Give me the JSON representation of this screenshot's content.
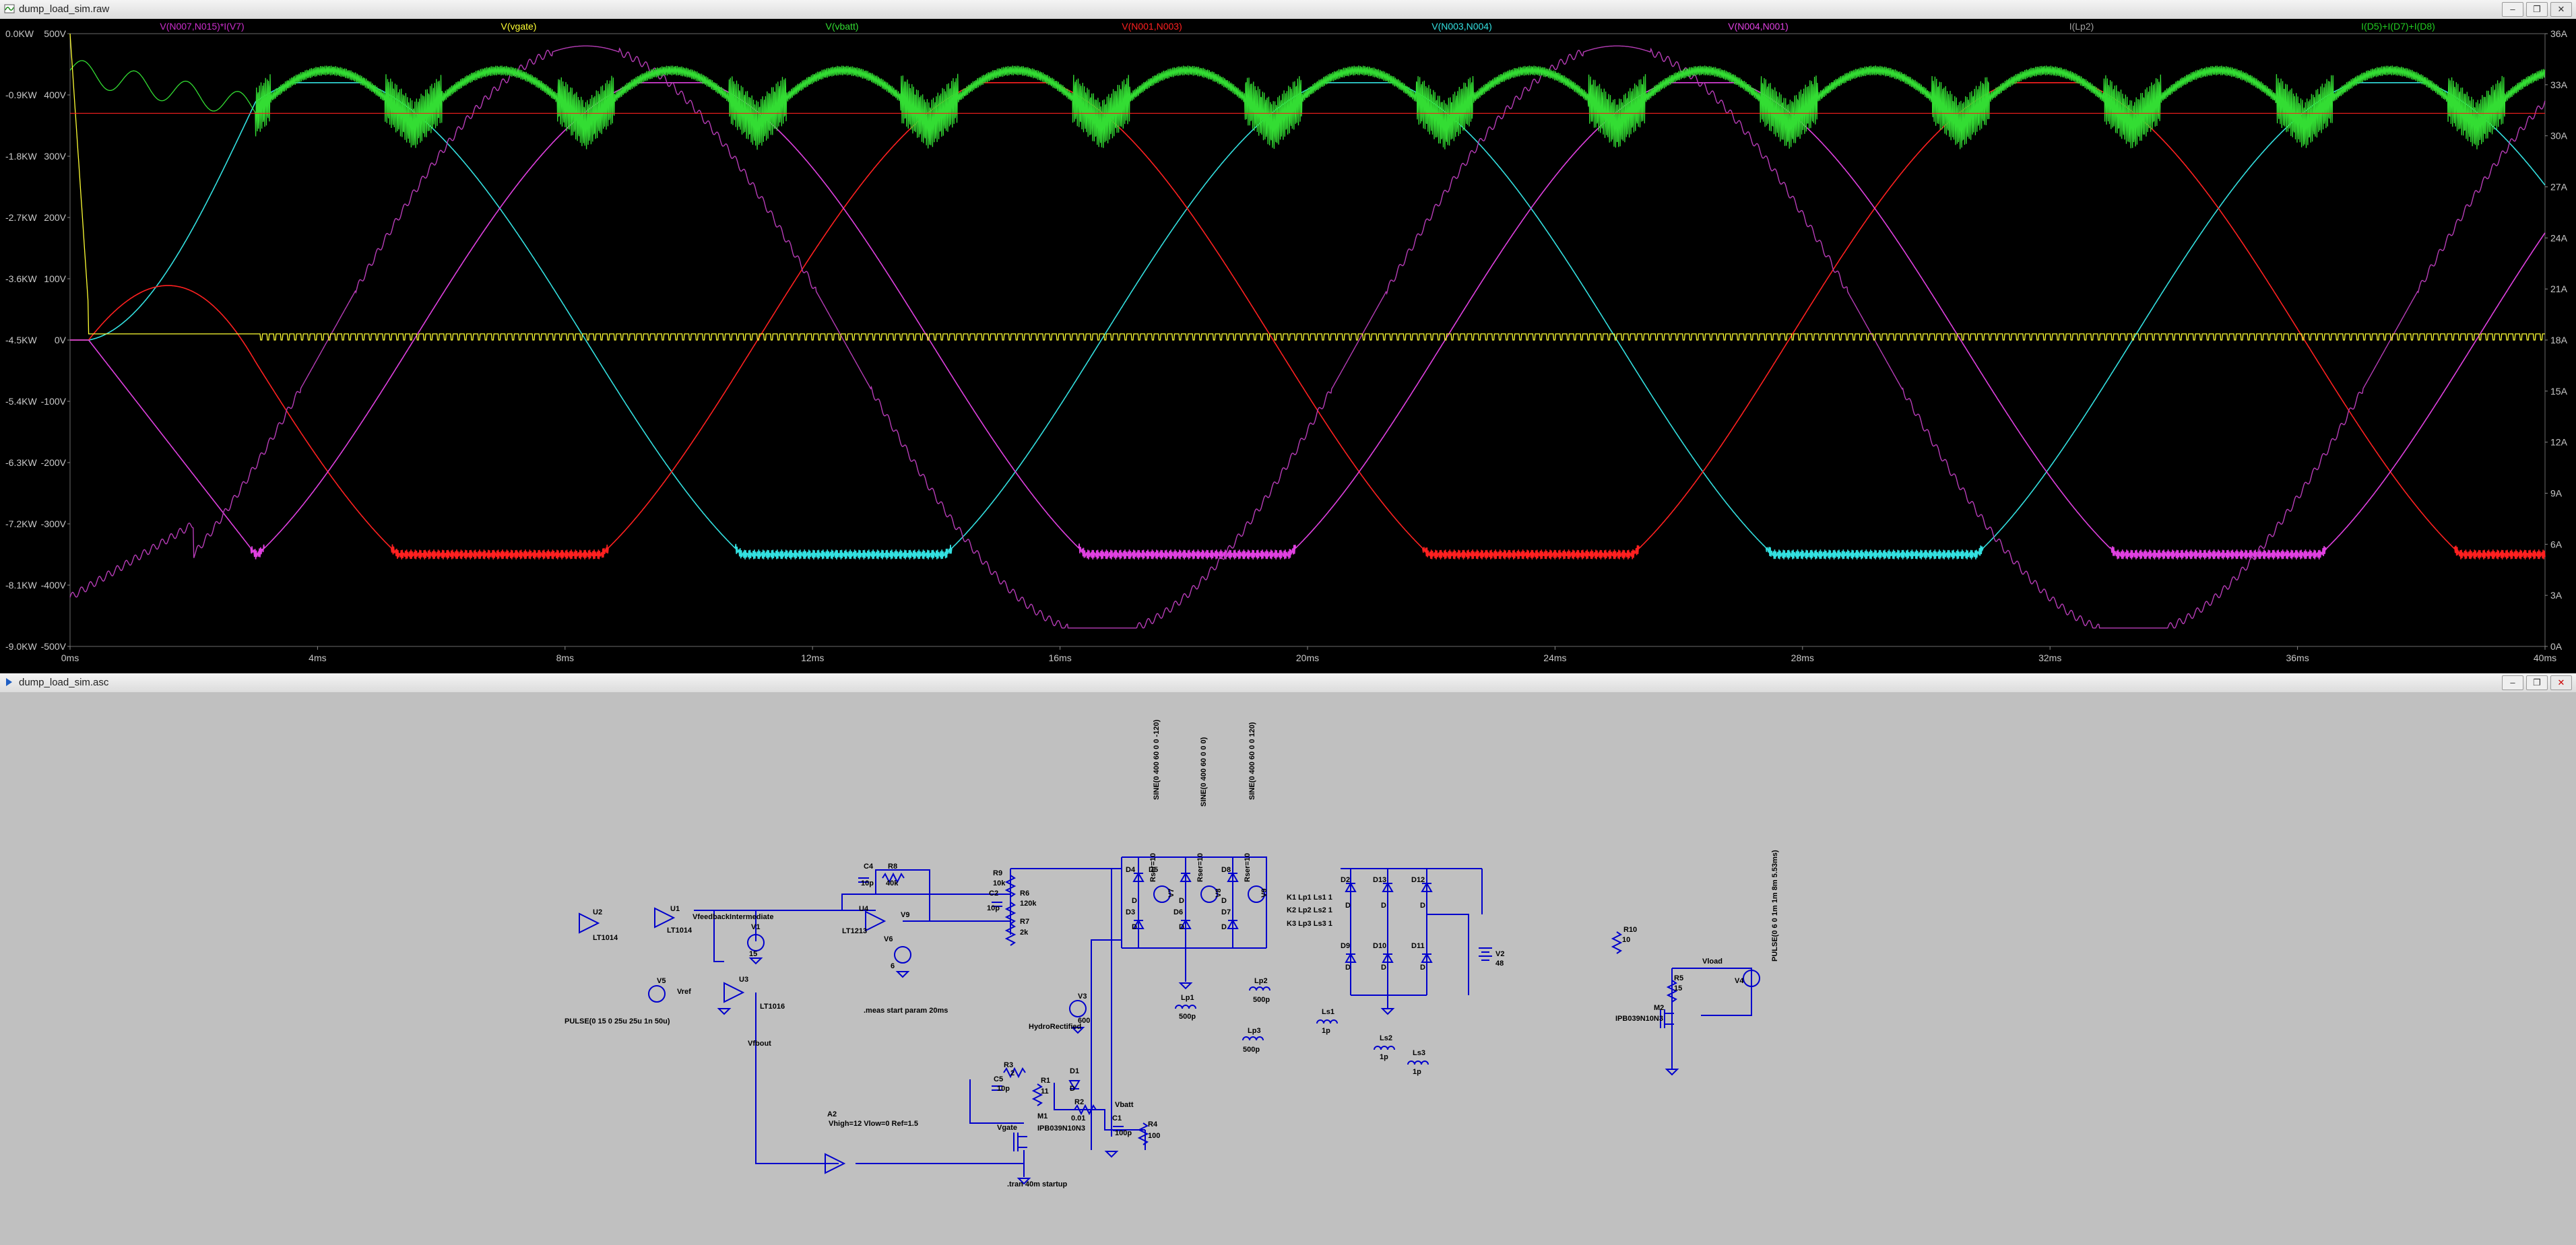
{
  "plot_window": {
    "title": "dump_load_sim.raw",
    "buttons": [
      "minimize",
      "restore",
      "close"
    ],
    "trace_labels": [
      {
        "text": "V(N007,N015)*I(V7)",
        "color": "#cc2ecc"
      },
      {
        "text": "V(vgate)",
        "color": "#ffff33"
      },
      {
        "text": "V(vbatt)",
        "color": "#33dd33"
      },
      {
        "text": "V(N001,N003)",
        "color": "#ff2020"
      },
      {
        "text": "V(N003,N004)",
        "color": "#33e0e0"
      },
      {
        "text": "V(N004,N001)",
        "color": "#e040e0"
      },
      {
        "text": "I(Lp2)",
        "color": "#a0a0a0"
      },
      {
        "text": "I(D5)+I(D7)+I(D8)",
        "color": "#22cc22"
      }
    ],
    "left_axis_1": [
      "0.0KW",
      "-0.9KW",
      "-1.8KW",
      "-2.7KW",
      "-3.6KW",
      "-4.5KW",
      "-5.4KW",
      "-6.3KW",
      "-7.2KW",
      "-8.1KW",
      "-9.0KW"
    ],
    "left_axis_2": [
      "500V",
      "400V",
      "300V",
      "200V",
      "100V",
      "0V",
      "-100V",
      "-200V",
      "-300V",
      "-400V",
      "-500V"
    ],
    "right_axis": [
      "36A",
      "33A",
      "30A",
      "27A",
      "24A",
      "21A",
      "18A",
      "15A",
      "12A",
      "9A",
      "6A",
      "3A",
      "0A"
    ],
    "x_axis": [
      "0ms",
      "4ms",
      "8ms",
      "12ms",
      "16ms",
      "20ms",
      "24ms",
      "28ms",
      "32ms",
      "36ms",
      "40ms"
    ]
  },
  "chart_data": {
    "type": "line",
    "x_unit": "ms",
    "xlim": [
      0,
      40
    ],
    "ylim_volts": [
      -500,
      500
    ],
    "series": [
      {
        "name": "V(N003,N004)",
        "color": "#33e0e0",
        "phase_deg": 0
      },
      {
        "name": "V(N001,N003)",
        "color": "#ff2020",
        "phase_deg": 120
      },
      {
        "name": "V(N004,N001)",
        "color": "#e040e0",
        "phase_deg": 240
      },
      {
        "name": "V(vbatt)",
        "color": "#33dd33"
      },
      {
        "name": "V(vgate)",
        "color": "#ffff33"
      }
    ]
  },
  "schematic_window": {
    "title": "dump_load_sim.asc",
    "labels": [
      {
        "text": "U2",
        "x": 880,
        "y": 330
      },
      {
        "text": "LT1014",
        "x": 880,
        "y": 368
      },
      {
        "text": "U1",
        "x": 995,
        "y": 325
      },
      {
        "text": "LT1014",
        "x": 990,
        "y": 357
      },
      {
        "text": "VfeedbackIntermediate",
        "x": 1028,
        "y": 337
      },
      {
        "text": "V1",
        "x": 1115,
        "y": 352
      },
      {
        "text": "15",
        "x": 1112,
        "y": 392
      },
      {
        "text": "U4",
        "x": 1275,
        "y": 325
      },
      {
        "text": "LT1213",
        "x": 1250,
        "y": 358
      },
      {
        "text": "V6",
        "x": 1312,
        "y": 370
      },
      {
        "text": "6",
        "x": 1322,
        "y": 410
      },
      {
        "text": "C4",
        "x": 1282,
        "y": 262
      },
      {
        "text": "10p",
        "x": 1278,
        "y": 287
      },
      {
        "text": "R8",
        "x": 1318,
        "y": 262
      },
      {
        "text": "40k",
        "x": 1315,
        "y": 287
      },
      {
        "text": "R9",
        "x": 1474,
        "y": 272
      },
      {
        "text": "10k",
        "x": 1474,
        "y": 287
      },
      {
        "text": "C2",
        "x": 1468,
        "y": 302
      },
      {
        "text": "10p",
        "x": 1465,
        "y": 324
      },
      {
        "text": "R6",
        "x": 1514,
        "y": 302
      },
      {
        "text": "120k",
        "x": 1514,
        "y": 317
      },
      {
        "text": "R7",
        "x": 1514,
        "y": 344
      },
      {
        "text": "2k",
        "x": 1514,
        "y": 360
      },
      {
        "text": "V9",
        "x": 1337,
        "y": 334
      },
      {
        "text": "V5",
        "x": 975,
        "y": 432
      },
      {
        "text": "Vref",
        "x": 1005,
        "y": 448
      },
      {
        "text": "U3",
        "x": 1097,
        "y": 430
      },
      {
        "text": "LT1016",
        "x": 1128,
        "y": 470
      },
      {
        "text": "PULSE(0 15 0 25u 25u 1n 50u)",
        "x": 838,
        "y": 492
      },
      {
        "text": ".meas start param 20ms",
        "x": 1282,
        "y": 476
      },
      {
        "text": "Vfbout",
        "x": 1110,
        "y": 525
      },
      {
        "text": "V3",
        "x": 1600,
        "y": 455
      },
      {
        "text": "600",
        "x": 1600,
        "y": 491
      },
      {
        "text": "R3",
        "x": 1490,
        "y": 557
      },
      {
        "text": "2",
        "x": 1500,
        "y": 569
      },
      {
        "text": "C5",
        "x": 1475,
        "y": 578
      },
      {
        "text": "10p",
        "x": 1480,
        "y": 592
      },
      {
        "text": "R1",
        "x": 1545,
        "y": 580
      },
      {
        "text": "11",
        "x": 1545,
        "y": 596
      },
      {
        "text": "M1",
        "x": 1540,
        "y": 633
      },
      {
        "text": "IPB039N10N3",
        "x": 1540,
        "y": 651
      },
      {
        "text": "D1",
        "x": 1588,
        "y": 566
      },
      {
        "text": "D",
        "x": 1588,
        "y": 592
      },
      {
        "text": "R2",
        "x": 1595,
        "y": 612
      },
      {
        "text": "0.01",
        "x": 1590,
        "y": 636
      },
      {
        "text": "Vbatt",
        "x": 1655,
        "y": 616
      },
      {
        "text": "C1",
        "x": 1651,
        "y": 636
      },
      {
        "text": "100p",
        "x": 1655,
        "y": 658
      },
      {
        "text": "R4",
        "x": 1704,
        "y": 645
      },
      {
        "text": "100",
        "x": 1704,
        "y": 662
      },
      {
        "text": "Vgate",
        "x": 1480,
        "y": 650
      },
      {
        "text": "A2",
        "x": 1228,
        "y": 630
      },
      {
        "text": "Vhigh=12 Vlow=0 Ref=1.5",
        "x": 1230,
        "y": 644
      },
      {
        "text": "HydroRectified",
        "x": 1527,
        "y": 500
      },
      {
        "text": ".tran 40m startup",
        "x": 1495,
        "y": 734
      },
      {
        "text": "D4",
        "x": 1671,
        "y": 267
      },
      {
        "text": "D5",
        "x": 1705,
        "y": 267
      },
      {
        "text": "D8",
        "x": 1813,
        "y": 267
      },
      {
        "text": "D3",
        "x": 1671,
        "y": 330
      },
      {
        "text": "D6",
        "x": 1742,
        "y": 330
      },
      {
        "text": "D7",
        "x": 1813,
        "y": 330
      },
      {
        "text": "D",
        "x": 1680,
        "y": 313
      },
      {
        "text": "D",
        "x": 1750,
        "y": 313
      },
      {
        "text": "D",
        "x": 1813,
        "y": 313
      },
      {
        "text": "D",
        "x": 1680,
        "y": 352
      },
      {
        "text": "D",
        "x": 1750,
        "y": 352
      },
      {
        "text": "D",
        "x": 1813,
        "y": 352
      },
      {
        "text": "SINE(0 400 60 0 0 -120)",
        "x": 1720,
        "y": 160,
        "rot": true
      },
      {
        "text": "SINE(0 400 60 0 0 0)",
        "x": 1790,
        "y": 170,
        "rot": true
      },
      {
        "text": "SINE(0 400 60 0 0 120)",
        "x": 1862,
        "y": 160,
        "rot": true
      },
      {
        "text": "Rser=10",
        "x": 1715,
        "y": 282,
        "rot": true
      },
      {
        "text": "Rser=10",
        "x": 1785,
        "y": 282,
        "rot": true
      },
      {
        "text": "Rser=10",
        "x": 1855,
        "y": 282,
        "rot": true
      },
      {
        "text": "V7",
        "x": 1742,
        "y": 305,
        "rot": true
      },
      {
        "text": "V8",
        "x": 1812,
        "y": 305,
        "rot": true
      },
      {
        "text": "V9",
        "x": 1880,
        "y": 305,
        "rot": true
      },
      {
        "text": "K1 Lp1 Ls1 1",
        "x": 1910,
        "y": 308
      },
      {
        "text": "K2 Lp2 Ls2 1",
        "x": 1910,
        "y": 327
      },
      {
        "text": "K3 Lp3 Ls3 1",
        "x": 1910,
        "y": 347
      },
      {
        "text": "Lp2",
        "x": 1862,
        "y": 432
      },
      {
        "text": "500p",
        "x": 1860,
        "y": 460
      },
      {
        "text": "Lp1",
        "x": 1753,
        "y": 457
      },
      {
        "text": "500p",
        "x": 1750,
        "y": 485
      },
      {
        "text": "Lp3",
        "x": 1852,
        "y": 506
      },
      {
        "text": "500p",
        "x": 1845,
        "y": 534
      },
      {
        "text": "Ls1",
        "x": 1962,
        "y": 478
      },
      {
        "text": "1p",
        "x": 1962,
        "y": 506
      },
      {
        "text": "Ls2",
        "x": 2048,
        "y": 517
      },
      {
        "text": "1p",
        "x": 2048,
        "y": 545
      },
      {
        "text": "Ls3",
        "x": 2097,
        "y": 539
      },
      {
        "text": "1p",
        "x": 2097,
        "y": 567
      },
      {
        "text": "D2",
        "x": 1990,
        "y": 282
      },
      {
        "text": "D13",
        "x": 2038,
        "y": 282
      },
      {
        "text": "D12",
        "x": 2095,
        "y": 282
      },
      {
        "text": "D9",
        "x": 1990,
        "y": 380
      },
      {
        "text": "D10",
        "x": 2038,
        "y": 380
      },
      {
        "text": "D11",
        "x": 2095,
        "y": 380
      },
      {
        "text": "D",
        "x": 1997,
        "y": 320
      },
      {
        "text": "D",
        "x": 2050,
        "y": 320
      },
      {
        "text": "D",
        "x": 2108,
        "y": 320
      },
      {
        "text": "D",
        "x": 1997,
        "y": 412
      },
      {
        "text": "D",
        "x": 2050,
        "y": 412
      },
      {
        "text": "D",
        "x": 2108,
        "y": 412
      },
      {
        "text": "V2",
        "x": 2220,
        "y": 392
      },
      {
        "text": "48",
        "x": 2220,
        "y": 406
      },
      {
        "text": "R10",
        "x": 2410,
        "y": 356
      },
      {
        "text": "10",
        "x": 2408,
        "y": 371
      },
      {
        "text": "Vload",
        "x": 2527,
        "y": 403
      },
      {
        "text": "R5",
        "x": 2485,
        "y": 428
      },
      {
        "text": "15",
        "x": 2485,
        "y": 443
      },
      {
        "text": "M2",
        "x": 2455,
        "y": 472
      },
      {
        "text": "IPB039N10N3",
        "x": 2398,
        "y": 488
      },
      {
        "text": "V4",
        "x": 2575,
        "y": 432
      },
      {
        "text": "PULSE(0 6 0 1m 1m 8m 5.53ms)",
        "x": 2638,
        "y": 400,
        "rot": true
      }
    ]
  }
}
